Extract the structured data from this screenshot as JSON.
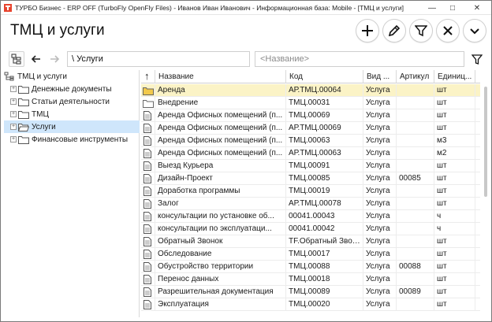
{
  "window": {
    "title": "ТУРБО Бизнес - ERP OFF (TurboFly OpenFly Files) - Иванов Иван Иванович - Информационная база: Mobile - [ТМЦ и услуги]"
  },
  "header": {
    "title": "ТМЦ и услуги",
    "buttons": [
      "plus-icon",
      "pencil-icon",
      "filter-icon",
      "close-icon",
      "chevron-down-icon"
    ]
  },
  "toolbar": {
    "path": "\\ Услуги",
    "name_placeholder": "<Название>"
  },
  "tree": {
    "root": "ТМЦ и услуги",
    "items": [
      {
        "label": "Денежные документы",
        "expander": "+"
      },
      {
        "label": "Статьи деятельности",
        "expander": "+"
      },
      {
        "label": "ТМЦ",
        "expander": "+"
      },
      {
        "label": "Услуги",
        "expander": "+",
        "selected": true
      },
      {
        "label": "Финансовые инструменты",
        "expander": "+"
      }
    ]
  },
  "table": {
    "sort_indicator": "↑",
    "columns": [
      "Название",
      "Код",
      "Вид ...",
      "Артикул",
      "Единиц..."
    ],
    "rows": [
      {
        "name": "Аренда",
        "code": "АР.ТМЦ.00064",
        "kind": "Услуга",
        "article": "",
        "unit": "шт",
        "folder": true,
        "selected": true
      },
      {
        "name": "Внедрение",
        "code": "ТМЦ.00031",
        "kind": "Услуга",
        "article": "",
        "unit": "шт",
        "folder": true
      },
      {
        "name": "Аренда Офисных помещений (п...",
        "code": "ТМЦ.00069",
        "kind": "Услуга",
        "article": "",
        "unit": "шт"
      },
      {
        "name": "Аренда Офисных помещений (п...",
        "code": "АР.ТМЦ.00069",
        "kind": "Услуга",
        "article": "",
        "unit": "шт"
      },
      {
        "name": "Аренда Офисных помещений (п...",
        "code": "ТМЦ.00063",
        "kind": "Услуга",
        "article": "",
        "unit": "м3"
      },
      {
        "name": "Аренда Офисных помещений (п...",
        "code": "АР.ТМЦ.00063",
        "kind": "Услуга",
        "article": "",
        "unit": "м2"
      },
      {
        "name": "Выезд Курьера",
        "code": "ТМЦ.00091",
        "kind": "Услуга",
        "article": "",
        "unit": "шт"
      },
      {
        "name": "Дизайн-Проект",
        "code": "ТМЦ.00085",
        "kind": "Услуга",
        "article": "00085",
        "unit": "шт"
      },
      {
        "name": "Доработка программы",
        "code": "ТМЦ.00019",
        "kind": "Услуга",
        "article": "",
        "unit": "шт"
      },
      {
        "name": "Залог",
        "code": "АР.ТМЦ.00078",
        "kind": "Услуга",
        "article": "",
        "unit": "шт"
      },
      {
        "name": "консультации по установке об...",
        "code": "00041.00043",
        "kind": "Услуга",
        "article": "",
        "unit": "ч"
      },
      {
        "name": "консультации по эксплуатаци...",
        "code": "00041.00042",
        "kind": "Услуга",
        "article": "",
        "unit": "ч"
      },
      {
        "name": "Обратный Звонок",
        "code": "ТF.Обратный Звон...",
        "kind": "Услуга",
        "article": "",
        "unit": "шт"
      },
      {
        "name": "Обследование",
        "code": "ТМЦ.00017",
        "kind": "Услуга",
        "article": "",
        "unit": "шт"
      },
      {
        "name": "Обустройство территории",
        "code": "ТМЦ.00088",
        "kind": "Услуга",
        "article": "00088",
        "unit": "шт"
      },
      {
        "name": "Перенос данных",
        "code": "ТМЦ.00018",
        "kind": "Услуга",
        "article": "",
        "unit": "шт"
      },
      {
        "name": "Разрешительная документация",
        "code": "ТМЦ.00089",
        "kind": "Услуга",
        "article": "00089",
        "unit": "шт"
      },
      {
        "name": "Эксплуатация",
        "code": "ТМЦ.00020",
        "kind": "Услуга",
        "article": "",
        "unit": "шт"
      }
    ]
  },
  "colors": {
    "selected_row": "#fbf3c6",
    "tree_selected": "#cfe6fb",
    "folder": "#f2c94c"
  }
}
